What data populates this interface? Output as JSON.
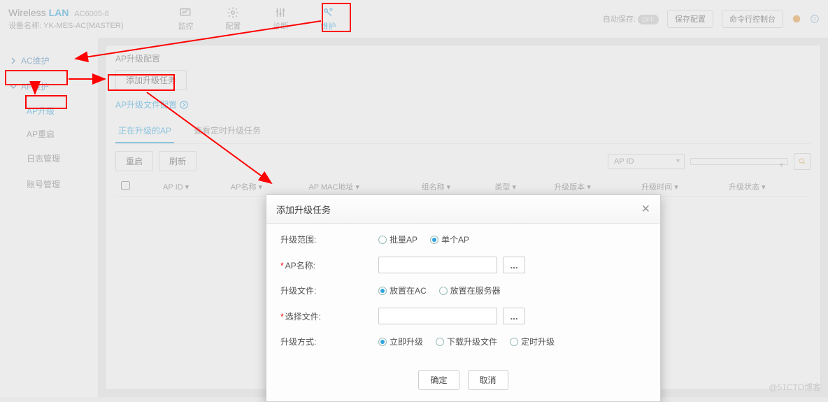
{
  "brand": {
    "name": "Wireless",
    "lan": "LAN",
    "model": "AC6005-8",
    "device_label_prefix": "设备名称:",
    "device_name": "YK-MES-AC(MASTER)"
  },
  "nav": {
    "items": [
      "监控",
      "配置",
      "诊断",
      "维护"
    ]
  },
  "header_right": {
    "autosave_label": "自动保存:",
    "autosave_state": "OFF",
    "save_btn": "保存配置",
    "console_btn": "命令行控制台"
  },
  "side": {
    "ac_maint": "AC维护",
    "ap_maint": "AP维护",
    "ap_upgrade": "AP升级",
    "ap_restart": "AP重启",
    "log_mgmt": "日志管理",
    "acct_mgmt": "账号管理"
  },
  "main": {
    "crumb": "AP升级配置",
    "add_task_btn": "添加升级任务",
    "file_cfg": "AP升级文件配置",
    "tab_active": "正在升级的AP",
    "tab_scheduled": "查看定时升级任务",
    "restart_btn": "重启",
    "refresh_btn": "刷新",
    "filter_sel": "AP ID",
    "cols": [
      "AP ID",
      "AP名称",
      "AP MAC地址",
      "组名称",
      "类型",
      "升级版本",
      "升级时间",
      "升级状态"
    ]
  },
  "modal": {
    "title": "添加升级任务",
    "scope_label": "升级范围:",
    "scope_batch": "批量AP",
    "scope_single": "单个AP",
    "ap_name_label": "AP名称:",
    "file_loc_label": "升级文件:",
    "file_ac": "放置在AC",
    "file_server": "放置在服务器",
    "select_file_label": "选择文件:",
    "method_label": "升级方式:",
    "method_now": "立即升级",
    "method_dl": "下载升级文件",
    "method_sched": "定时升级",
    "ok": "确定",
    "cancel": "取消"
  },
  "watermark": "@51CTO博客"
}
